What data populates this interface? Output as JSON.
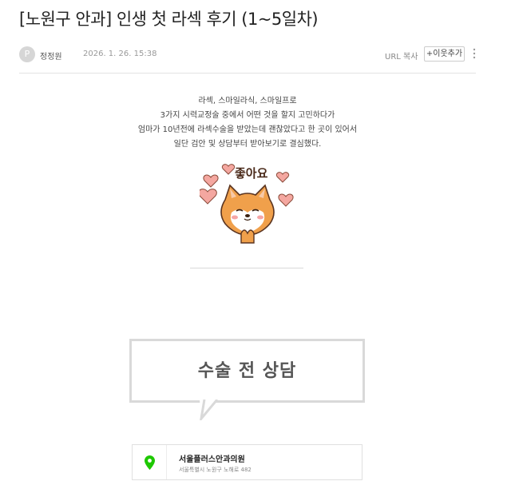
{
  "post": {
    "title": "[노원구 안과] 인생 첫 라섹 후기 (1~5일차)",
    "author_initial": "P",
    "author": "정정원",
    "date": "2026. 1. 26. 15:38",
    "url_copy_label": "URL 복사",
    "neighbor_button_label": "+이웃추가"
  },
  "intro_lines": [
    "라섹, 스마일라식, 스마일프로",
    "3가지 시력교정술 중에서 어떤 것을 할지 고민하다가",
    "엄마가 10년전에 라섹수술을 받았는데 괜찮았다고 한 곳이 있어서",
    "일단 검안 및 상담부터 받아보기로 결심했다."
  ],
  "sticker": {
    "text": "좋아요",
    "icon": "shiba-dog-sticker",
    "heart_color": "#f4a7a0",
    "fur_color": "#f0a04b"
  },
  "quote": {
    "text": "수술 전 상담"
  },
  "place": {
    "name": "서울플러스안과의원",
    "address": "서울특별시 노원구 노해로 482",
    "pin_color": "#1ec800"
  }
}
